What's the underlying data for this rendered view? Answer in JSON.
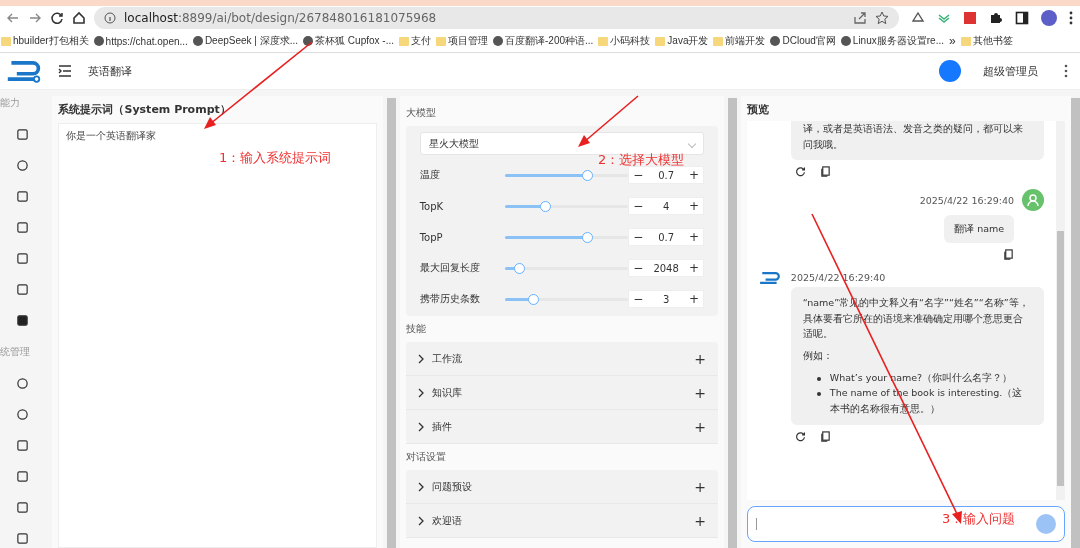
{
  "browser": {
    "url_host": "localhost",
    "url_rest": ":8899/ai/bot/design/267848016181075968",
    "bookmarks": [
      {
        "label": "hbuilder打包相关",
        "kind": "folder"
      },
      {
        "label": "https://chat.open...",
        "kind": "site"
      },
      {
        "label": "DeepSeek | 深度求...",
        "kind": "site"
      },
      {
        "label": "茶杯狐 Cupfox -...",
        "kind": "site"
      },
      {
        "label": "支付",
        "kind": "folder"
      },
      {
        "label": "项目管理",
        "kind": "folder"
      },
      {
        "label": "百度翻译-200种语...",
        "kind": "site"
      },
      {
        "label": "小码科技",
        "kind": "folder"
      },
      {
        "label": "Java开发",
        "kind": "folder"
      },
      {
        "label": "前端开发",
        "kind": "folder"
      },
      {
        "label": "DCloud官网",
        "kind": "site"
      },
      {
        "label": "Linux服务器设置re...",
        "kind": "site"
      }
    ],
    "more": "»",
    "other_bookmarks": "其他书签"
  },
  "header": {
    "page_title": "英语翻译",
    "user_name": "超级管理员"
  },
  "sidebar": {
    "sections": [
      {
        "label": "能力"
      },
      {
        "label": "统管理"
      }
    ]
  },
  "prompt": {
    "title": "系统提示词（System Prompt）",
    "value": "你是一个英语翻译家"
  },
  "config": {
    "model_section": "大模型",
    "model_select": "星火大模型",
    "params": [
      {
        "label": "温度",
        "level": 0.67,
        "value": "0.7"
      },
      {
        "label": "TopK",
        "level": 0.33,
        "value": "4"
      },
      {
        "label": "TopP",
        "level": 0.67,
        "value": "0.7"
      },
      {
        "label": "最大回复长度",
        "level": 0.12,
        "value": "2048"
      },
      {
        "label": "携带历史条数",
        "level": 0.23,
        "value": "3"
      }
    ],
    "minus": "−",
    "plus": "+",
    "groups": [
      {
        "title": "技能",
        "items": [
          "工作流",
          "知识库",
          "插件"
        ]
      },
      {
        "title": "对话设置",
        "items": [
          "问题预设",
          "欢迎语"
        ]
      }
    ]
  },
  "preview": {
    "title": "预览",
    "messages": [
      {
        "kind": "bot",
        "paragraphs": [
          "译，或者是英语语法、发音之类的疑问，都可以来问我哦。"
        ]
      },
      {
        "kind": "user",
        "time": "2025/4/22 16:29:40",
        "paragraphs": [
          "翻译 name"
        ]
      },
      {
        "kind": "bot",
        "time": "2025/4/22 16:29:40",
        "paragraphs": [
          "“name”常见的中文释义有“名字”“姓名”“名称”等，具体要看它所在的语境来准确确定用哪个意思更合适呢。",
          "例如："
        ],
        "bullets": [
          "What’s your name?（你叫什么名字？）",
          "The name of the book is interesting.（这本书的名称很有意思。）"
        ]
      }
    ]
  },
  "annotations": [
    "1：输入系统提示词",
    "2：选择大模型",
    "3：输入问题"
  ]
}
